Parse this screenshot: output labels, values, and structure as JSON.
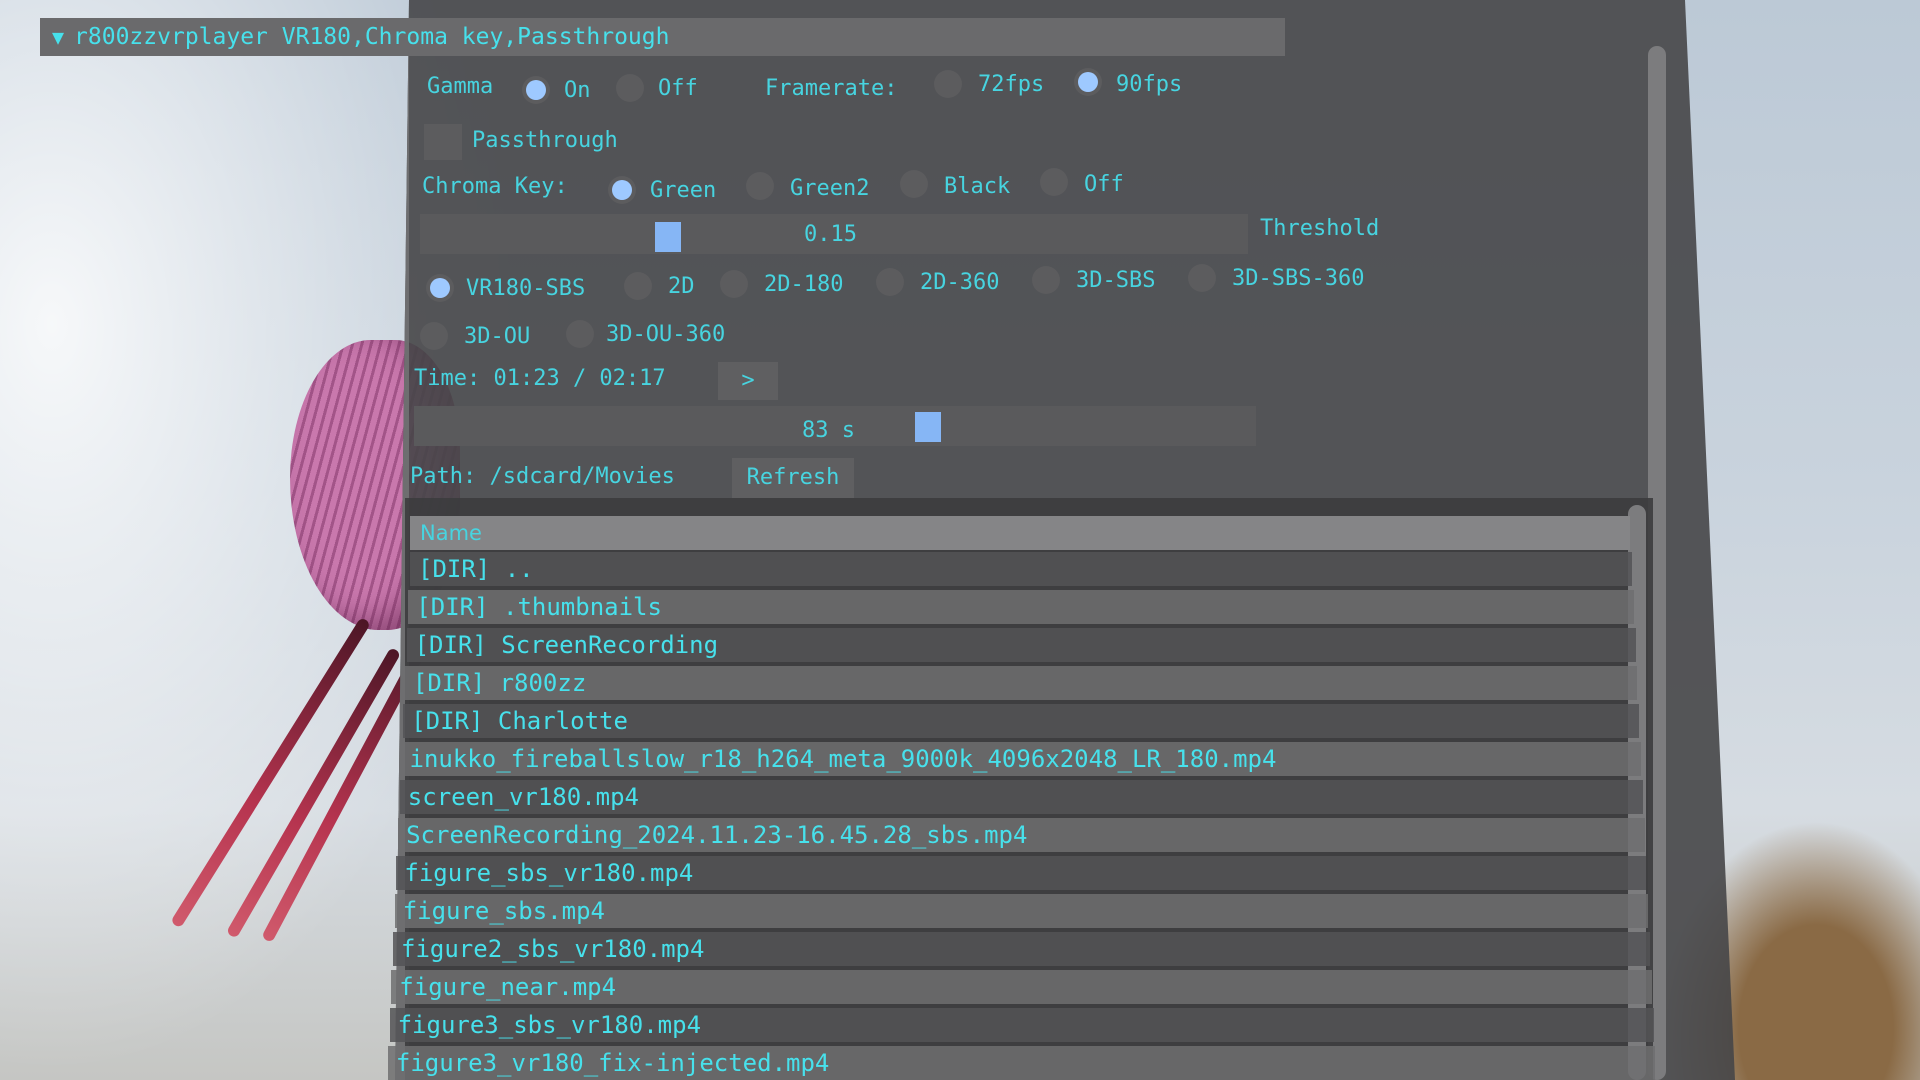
{
  "window": {
    "title": "r800zzvrplayer VR180,Chroma key,Passthrough"
  },
  "gamma": {
    "label": "Gamma",
    "options": [
      "On",
      "Off"
    ],
    "selected": "On"
  },
  "framerate": {
    "label": "Framerate:",
    "options": [
      "72fps",
      "90fps"
    ],
    "selected": "90fps"
  },
  "passthrough": {
    "label": "Passthrough",
    "checked": false
  },
  "chroma_key": {
    "label": "Chroma Key:",
    "options": [
      "Green",
      "Green2",
      "Black",
      "Off"
    ],
    "selected": "Green"
  },
  "threshold": {
    "label": "Threshold",
    "value": "0.15"
  },
  "projection": {
    "options": [
      "VR180-SBS",
      "2D",
      "2D-180",
      "2D-360",
      "3D-SBS",
      "3D-SBS-360",
      "3D-OU",
      "3D-OU-360"
    ],
    "selected": "VR180-SBS"
  },
  "playback": {
    "time_label": "Time: 01:23 / 02:17",
    "play_button": ">",
    "seek_value": "83 s",
    "seek_fraction": 0.61
  },
  "browser": {
    "path_label": "Path: /sdcard/Movies",
    "refresh_label": "Refresh",
    "column_name": "Name",
    "files": [
      "[DIR] ..",
      "[DIR] .thumbnails",
      "[DIR] ScreenRecording",
      "[DIR] r800zz",
      "[DIR] Charlotte",
      "inukko_fireballslow_r18_h264_meta_9000k_4096x2048_LR_180.mp4",
      "screen_vr180.mp4",
      "ScreenRecording_2024.11.23-16.45.28_sbs.mp4",
      "figure_sbs_vr180.mp4",
      "figure_sbs.mp4",
      "figure2_sbs_vr180.mp4",
      "figure_near.mp4",
      "figure3_sbs_vr180.mp4",
      "figure3_vr180_fix-injected.mp4"
    ]
  }
}
